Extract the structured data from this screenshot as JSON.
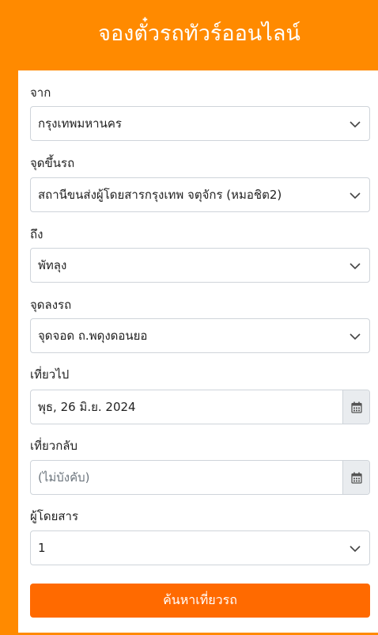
{
  "header": {
    "title": "จองตั๋วรถทัวร์ออนไลน์"
  },
  "form": {
    "from": {
      "label": "จาก",
      "value": "กรุงเทพมหานคร"
    },
    "boarding_point": {
      "label": "จุดขึ้นรถ",
      "value": "สถานีขนส่งผู้โดยสารกรุงเทพ จตุจักร (หมอชิต2)"
    },
    "to": {
      "label": "ถึง",
      "value": "พัทลุง"
    },
    "dropoff_point": {
      "label": "จุดลงรถ",
      "value": "จุดจอด ถ.พดุงดอนยอ"
    },
    "depart": {
      "label": "เที่ยวไป",
      "value": "พุธ, 26 มิ.ย. 2024"
    },
    "return": {
      "label": "เที่ยวกลับ",
      "placeholder": "(ไม่บังคับ)"
    },
    "passengers": {
      "label": "ผู้โดยสาร",
      "value": "1"
    },
    "search_label": "ค้นหาเที่ยวรถ"
  },
  "icons": {
    "select_arrow": "chevron-down-icon",
    "date_picker": "calendar-icon"
  },
  "colors": {
    "header_bg": "#ff8a00",
    "button_bg": "#ff6a00",
    "addon_bg": "#e9ecef"
  }
}
